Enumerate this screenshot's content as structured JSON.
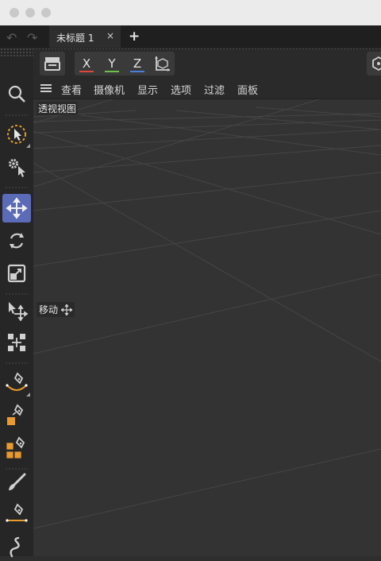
{
  "window": {
    "controls": [
      "close",
      "minimize",
      "zoom"
    ]
  },
  "tabs": {
    "items": [
      {
        "label": "未标题 1",
        "close": "×"
      }
    ],
    "add_label": "+",
    "undo_icon": "undo-icon",
    "redo_icon": "redo-icon"
  },
  "toolbar": {
    "axes": [
      {
        "label": "X",
        "color": "#d9473d"
      },
      {
        "label": "Y",
        "color": "#6fbf4a"
      },
      {
        "label": "Z",
        "color": "#4b7fd6"
      }
    ],
    "icons": [
      "clapboard-icon",
      "coordinate-system-icon",
      "render-icon"
    ]
  },
  "viewport_menu": {
    "items": [
      "查看",
      "摄像机",
      "显示",
      "选项",
      "过滤",
      "面板"
    ]
  },
  "viewport": {
    "title": "透视视图",
    "tool_tip": "移动",
    "background": "#333333",
    "grid_color": "#4a4a4a"
  },
  "left_toolbar": {
    "tools": [
      "search-icon",
      "live-selection-icon",
      "gear-select-icon",
      "move-icon",
      "rotate-icon",
      "scale-icon",
      "axis-move-icon",
      "transform-icon",
      "pen-spline-icon",
      "pen-square-icon",
      "pen-cubes-icon",
      "brush-icon",
      "pen-line-icon",
      "spline-sketch-icon"
    ],
    "active_tool": "move-icon",
    "active_color": "#5b6bb8",
    "accent_color": "#e89a2e"
  }
}
